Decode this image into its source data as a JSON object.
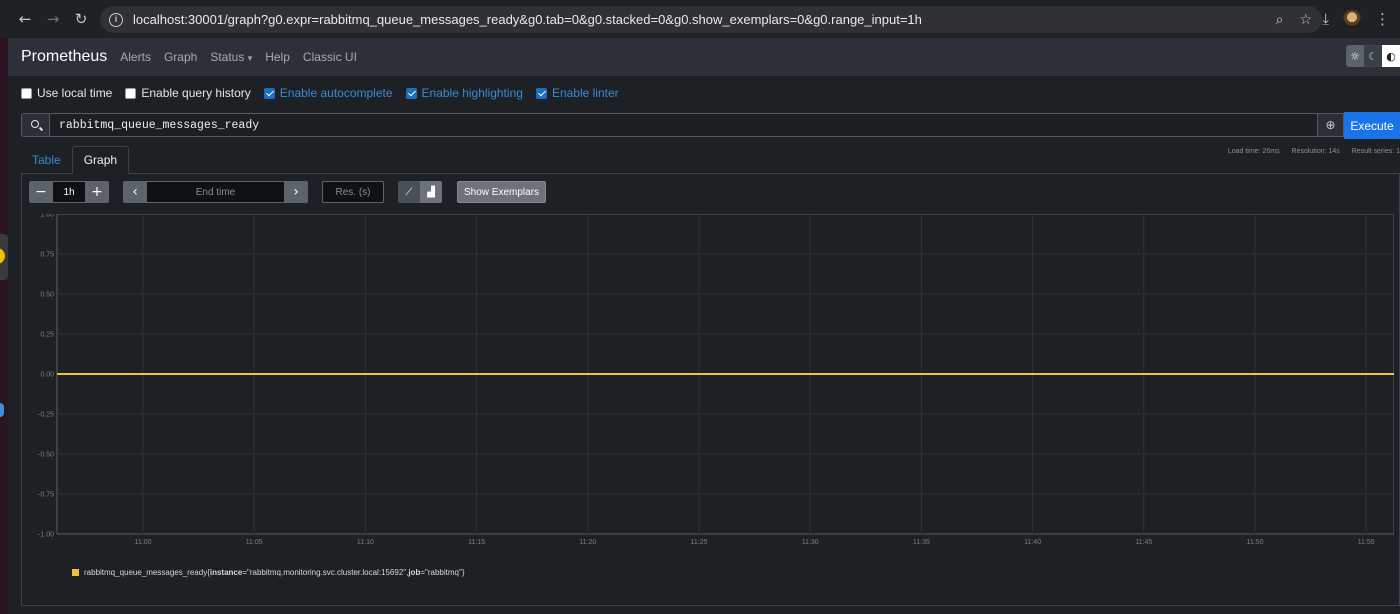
{
  "browser": {
    "url": "localhost:30001/graph?g0.expr=rabbitmq_queue_messages_ready&g0.tab=0&g0.stacked=0&g0.show_exemplars=0&g0.range_input=1h",
    "icons": [
      "back-arrow-icon",
      "forward-arrow-icon",
      "reload-icon",
      "site-info-icon",
      "zoom-icon",
      "bookmark-star-icon",
      "download-icon",
      "profile-avatar-icon",
      "more-menu-icon"
    ]
  },
  "navbar": {
    "brand": "Prometheus",
    "links": [
      "Alerts",
      "Graph",
      "Status",
      "Help",
      "Classic UI"
    ],
    "status_caret": "▾"
  },
  "options": [
    {
      "label": "Use local time",
      "checked": false
    },
    {
      "label": "Enable query history",
      "checked": false
    },
    {
      "label": "Enable autocomplete",
      "checked": true
    },
    {
      "label": "Enable highlighting",
      "checked": true
    },
    {
      "label": "Enable linter",
      "checked": true
    }
  ],
  "query": {
    "expression": "rabbitmq_queue_messages_ready",
    "execute_label": "Execute"
  },
  "tabs": [
    {
      "label": "Table",
      "active": false
    },
    {
      "label": "Graph",
      "active": true
    }
  ],
  "stats": {
    "load_time": "Load time: 26ms",
    "resolution": "Resolution: 14s",
    "result_series": "Result series: 1"
  },
  "controls": {
    "minus": "−",
    "plus": "+",
    "range": "1h",
    "prev": "‹",
    "next": "›",
    "end_time_placeholder": "End time",
    "res_placeholder": "Res. (s)",
    "show_exemplars": "Show Exemplars"
  },
  "chart_data": {
    "type": "line",
    "ylim": [
      -1.0,
      1.0
    ],
    "y_ticks": [
      "1.00",
      "0.75",
      "0.50",
      "0.25",
      "0.00",
      "-0.25",
      "-0.50",
      "-0.75",
      "-1.00"
    ],
    "x_ticks": [
      "11:00",
      "11:05",
      "11:10",
      "11:15",
      "11:20",
      "11:25",
      "11:30",
      "11:35",
      "11:40",
      "11:45",
      "11:50",
      "11:55"
    ],
    "grid": true,
    "series": [
      {
        "name": "rabbitmq_queue_messages_ready{instance=\"rabbitmq.monitoring.svc.cluster.local:15692\", job=\"rabbitmq\"}",
        "color": "#edc240",
        "values": [
          0,
          0
        ]
      }
    ]
  },
  "legend": {
    "metric": "rabbitmq_queue_messages_ready",
    "open": "{",
    "instance_key": "instance",
    "instance_val": "=\"rabbitmq.monitoring.svc.cluster.local:15692\", ",
    "job_key": "job",
    "job_val": "=\"rabbitmq\"",
    "close": "}"
  }
}
